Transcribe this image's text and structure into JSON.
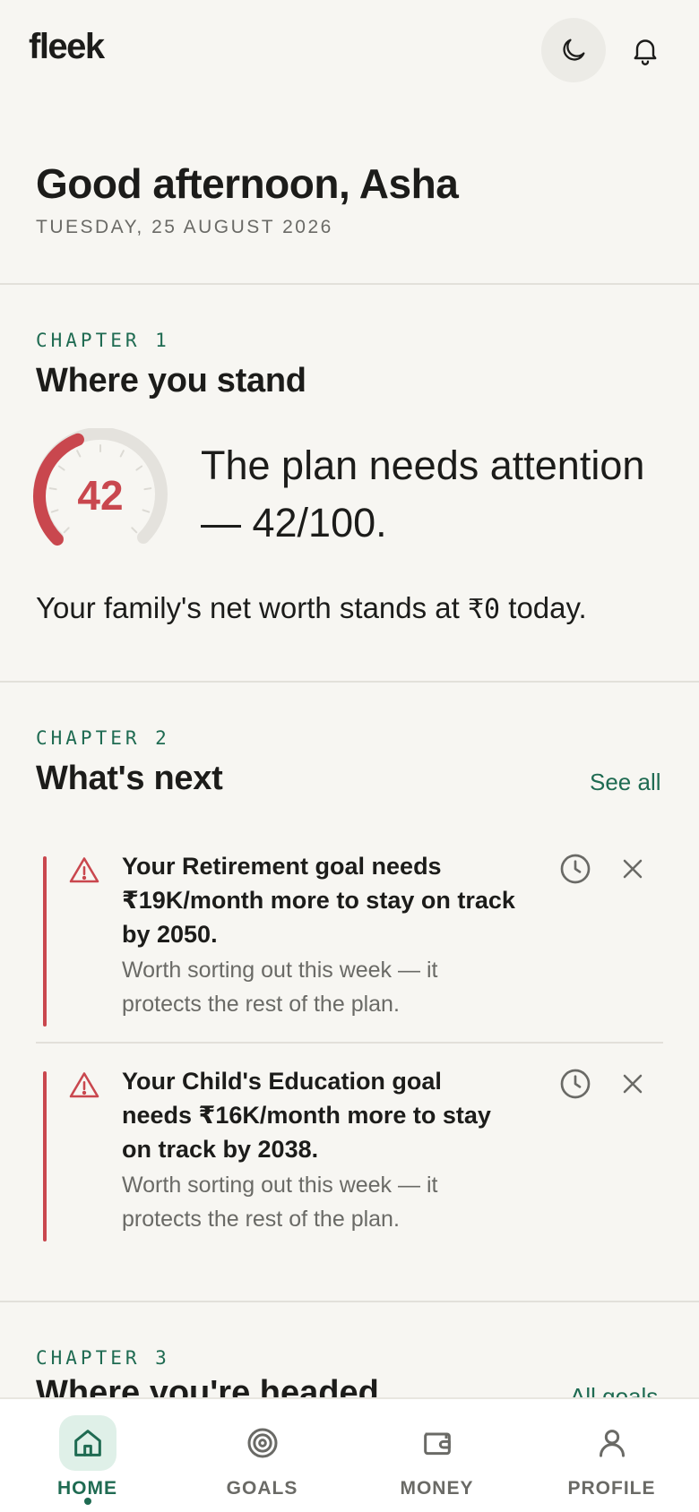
{
  "app": {
    "logo": "fleek"
  },
  "header": {
    "theme_toggle_icon": "moon-icon",
    "notifications_icon": "bell-icon"
  },
  "greeting": {
    "text": "Good afternoon, Asha",
    "date": "TUESDAY, 25 AUGUST 2026"
  },
  "chapter1": {
    "label": "CHAPTER 1",
    "title": "Where you stand",
    "score": "42",
    "score_value": 42,
    "score_max": 100,
    "headline": "The plan needs attention — 42/100.",
    "networth_prefix": "Your family's net worth stands at ",
    "networth_value": "₹0",
    "networth_suffix": " today."
  },
  "chapter2": {
    "label": "CHAPTER 2",
    "title": "What's next",
    "see_all": "See all",
    "cards": [
      {
        "title": "Your Retirement goal needs ₹19K/month more to stay on track by 2050.",
        "desc": "Worth sorting out this week — it protects the rest of the plan."
      },
      {
        "title": "Your Child's Education goal needs ₹16K/month more to stay on track by 2038.",
        "desc": "Worth sorting out this week — it protects the rest of the plan."
      }
    ]
  },
  "chapter3": {
    "label": "CHAPTER 3",
    "title": "Where you're headed",
    "link": "All goals"
  },
  "nav": {
    "items": [
      {
        "label": "HOME",
        "icon": "home-icon",
        "active": true
      },
      {
        "label": "GOALS",
        "icon": "target-icon",
        "active": false
      },
      {
        "label": "MONEY",
        "icon": "wallet-icon",
        "active": false
      },
      {
        "label": "PROFILE",
        "icon": "user-icon",
        "active": false
      }
    ]
  },
  "colors": {
    "accent": "#1f6b52",
    "alert": "#c9474e",
    "background": "#f7f6f2"
  }
}
